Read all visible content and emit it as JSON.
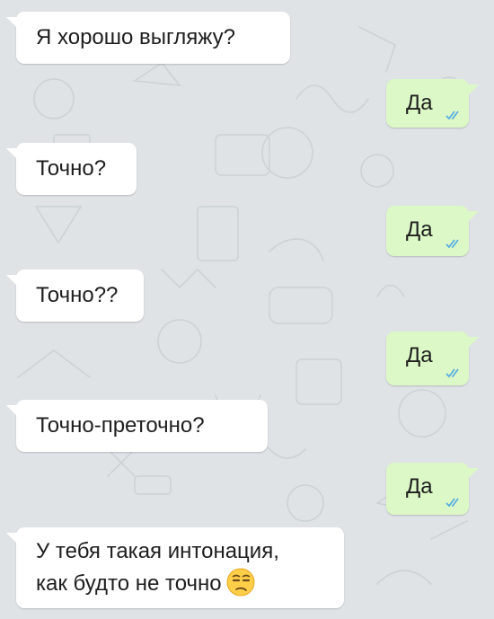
{
  "chat": {
    "messages": [
      {
        "direction": "in",
        "text": "Я хорошо выгляжу?"
      },
      {
        "direction": "out",
        "text": "Да",
        "status": "double-check-read-icon"
      },
      {
        "direction": "in",
        "text": "Точно?"
      },
      {
        "direction": "out",
        "text": "Да",
        "status": "double-check-read-icon"
      },
      {
        "direction": "in",
        "text": "Точно??"
      },
      {
        "direction": "out",
        "text": "Да",
        "status": "double-check-read-icon"
      },
      {
        "direction": "in",
        "text": "Точно-преточно?"
      },
      {
        "direction": "out",
        "text": "Да",
        "status": "double-check-read-icon"
      },
      {
        "direction": "in",
        "lines": [
          "У тебя такая интонация,",
          "как будто не точно"
        ],
        "emoji": "unamused-face-emoji"
      }
    ]
  },
  "colors": {
    "wallpaper": "#dfe3e6",
    "incoming_bubble": "#ffffff",
    "outgoing_bubble": "#dcf8c6",
    "read_ticks": "#4fa8e5"
  },
  "wallpaper_pattern": "doodle-wallpaper"
}
